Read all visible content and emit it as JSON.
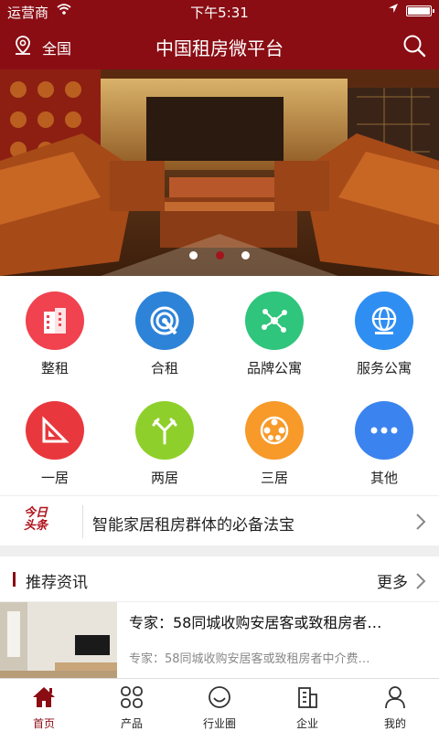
{
  "statusbar": {
    "carrier": "运营商",
    "time": "下午5:31"
  },
  "navbar": {
    "region": "全国",
    "title": "中国租房微平台"
  },
  "banner": {
    "slide_count": 3,
    "active_slide": 2
  },
  "categories": [
    {
      "label": "整租",
      "icon": "building-icon",
      "color": "#f0424f"
    },
    {
      "label": "合租",
      "icon": "signal-icon",
      "color": "#2d83d8"
    },
    {
      "label": "品牌公寓",
      "icon": "network-icon",
      "color": "#2fc57c"
    },
    {
      "label": "服务公寓",
      "icon": "globe-icon",
      "color": "#2f8ef2"
    },
    {
      "label": "一居",
      "icon": "ruler-icon",
      "color": "#e8383d"
    },
    {
      "label": "两居",
      "icon": "antenna-icon",
      "color": "#8fcf2b"
    },
    {
      "label": "三居",
      "icon": "film-icon",
      "color": "#f79a2a"
    },
    {
      "label": "其他",
      "icon": "more-icon",
      "color": "#3b84ef"
    }
  ],
  "headline": {
    "logo_line1": "今日",
    "logo_line2": "头条",
    "text": "智能家居租房群体的必备法宝"
  },
  "section": {
    "title": "推荐资讯",
    "more": "更多"
  },
  "news": [
    {
      "title": "专家：58同城收购安居客或致租房者…",
      "summary": "专家：58同城收购安居客或致租房者中介费…"
    }
  ],
  "tabs": [
    {
      "label": "首页",
      "icon": "home-icon",
      "active": true
    },
    {
      "label": "产品",
      "icon": "grid-icon",
      "active": false
    },
    {
      "label": "行业圈",
      "icon": "smile-icon",
      "active": false
    },
    {
      "label": "企业",
      "icon": "company-icon",
      "active": false
    },
    {
      "label": "我的",
      "icon": "user-icon",
      "active": false
    }
  ],
  "colors": {
    "brand": "#8a0d14",
    "accent": "#b0121b"
  }
}
